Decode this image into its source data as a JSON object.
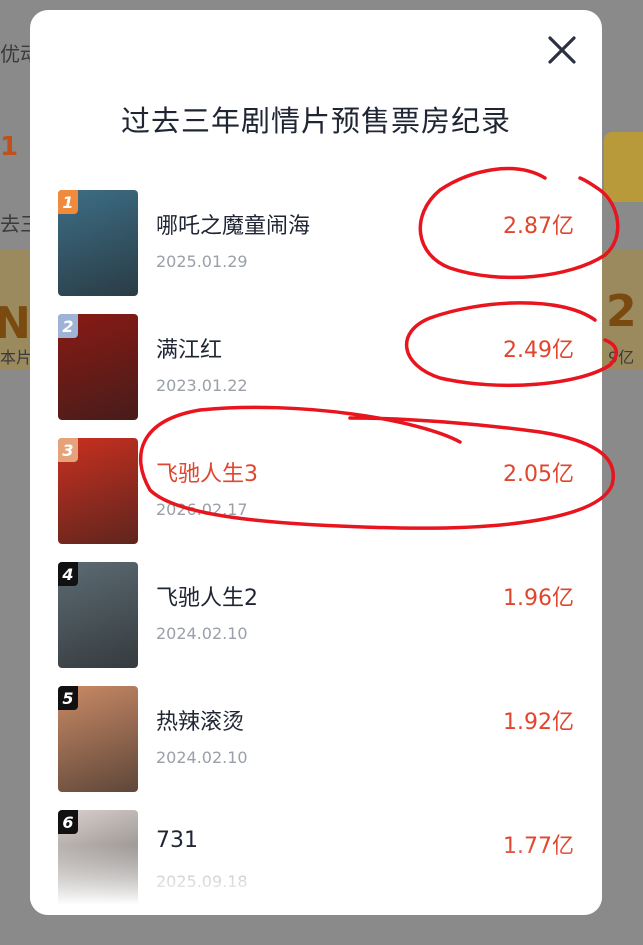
{
  "background": {
    "fragments": [
      "优动",
      "1",
      "去三",
      "本片",
      "9亿"
    ],
    "numbers": [
      "NO",
      "2"
    ]
  },
  "modal": {
    "title": "过去三年剧情片预售票房纪录",
    "close_icon": "close-icon"
  },
  "movies": [
    {
      "rank": "1",
      "title": "哪吒之魔童闹海",
      "date": "2025.01.29",
      "box_office": "2.87亿",
      "rank_color": "#f08a3c",
      "poster_color": "#3d6e86"
    },
    {
      "rank": "2",
      "title": "满江红",
      "date": "2023.01.22",
      "box_office": "2.49亿",
      "rank_color": "#9fb3d6",
      "poster_color": "#8a1a14"
    },
    {
      "rank": "3",
      "title": "飞驰人生3",
      "date": "2026.02.17",
      "box_office": "2.05亿",
      "rank_color": "#e6a37a",
      "poster_color": "#c9301f"
    },
    {
      "rank": "4",
      "title": "飞驰人生2",
      "date": "2024.02.10",
      "box_office": "1.96亿",
      "rank_color": "#111111",
      "poster_color": "#5c6b73"
    },
    {
      "rank": "5",
      "title": "热辣滚烫",
      "date": "2024.02.10",
      "box_office": "1.92亿",
      "rank_color": "#111111",
      "poster_color": "#c98a66"
    },
    {
      "rank": "6",
      "title": "731",
      "date": "2025.09.18",
      "box_office": "1.77亿",
      "rank_color": "#111111",
      "poster_color": "#d8d0cc"
    }
  ],
  "annotation_color": "#e8141e"
}
